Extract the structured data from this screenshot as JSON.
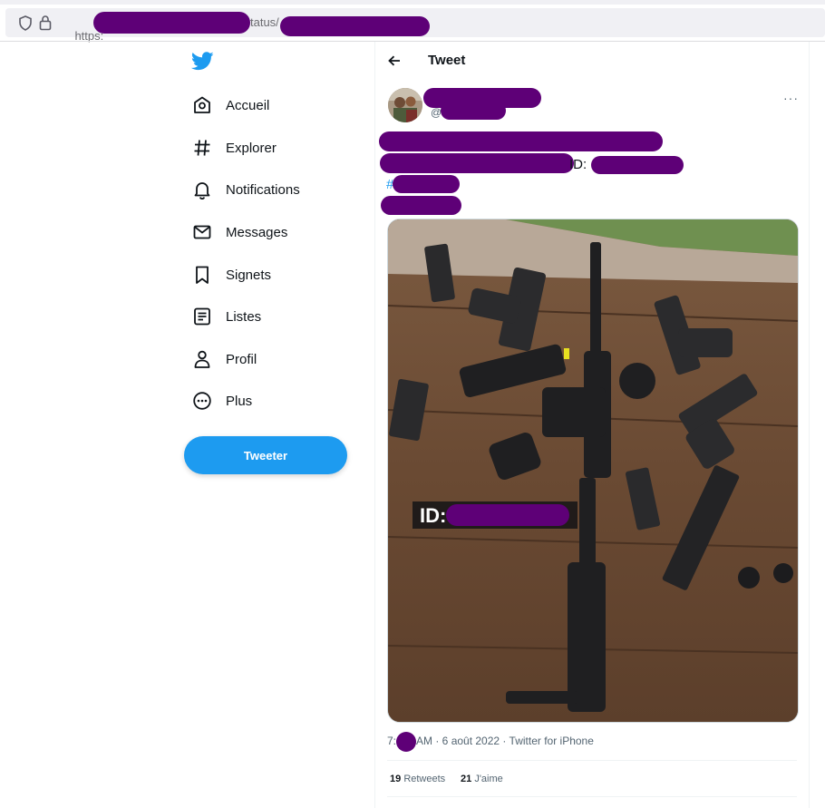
{
  "browser": {
    "url_prefix": "https:",
    "url_segment": "tatus/"
  },
  "nav": {
    "items": [
      {
        "label": "Accueil",
        "icon": "home-icon"
      },
      {
        "label": "Explorer",
        "icon": "hashtag-icon"
      },
      {
        "label": "Notifications",
        "icon": "bell-icon"
      },
      {
        "label": "Messages",
        "icon": "envelope-icon"
      },
      {
        "label": "Signets",
        "icon": "bookmark-icon"
      },
      {
        "label": "Listes",
        "icon": "list-icon"
      },
      {
        "label": "Profil",
        "icon": "person-icon"
      },
      {
        "label": "Plus",
        "icon": "more-circle-icon"
      }
    ],
    "tweet_button": "Tweeter"
  },
  "header": {
    "title": "Tweet"
  },
  "tweet": {
    "handle_prefix": "@",
    "more": "···",
    "id_label": "ID:",
    "hashtag_prefix": "#",
    "media_overlay": "ID:",
    "time_prefix": "7:",
    "time_suffix": "AM · 6 août 2022 · Twitter for iPhone",
    "retweets_count": "19",
    "retweets_label": "Retweets",
    "likes_count": "21",
    "likes_label": "J'aime"
  },
  "colors": {
    "accent": "#1d9bf0",
    "redaction": "#5e0077"
  }
}
